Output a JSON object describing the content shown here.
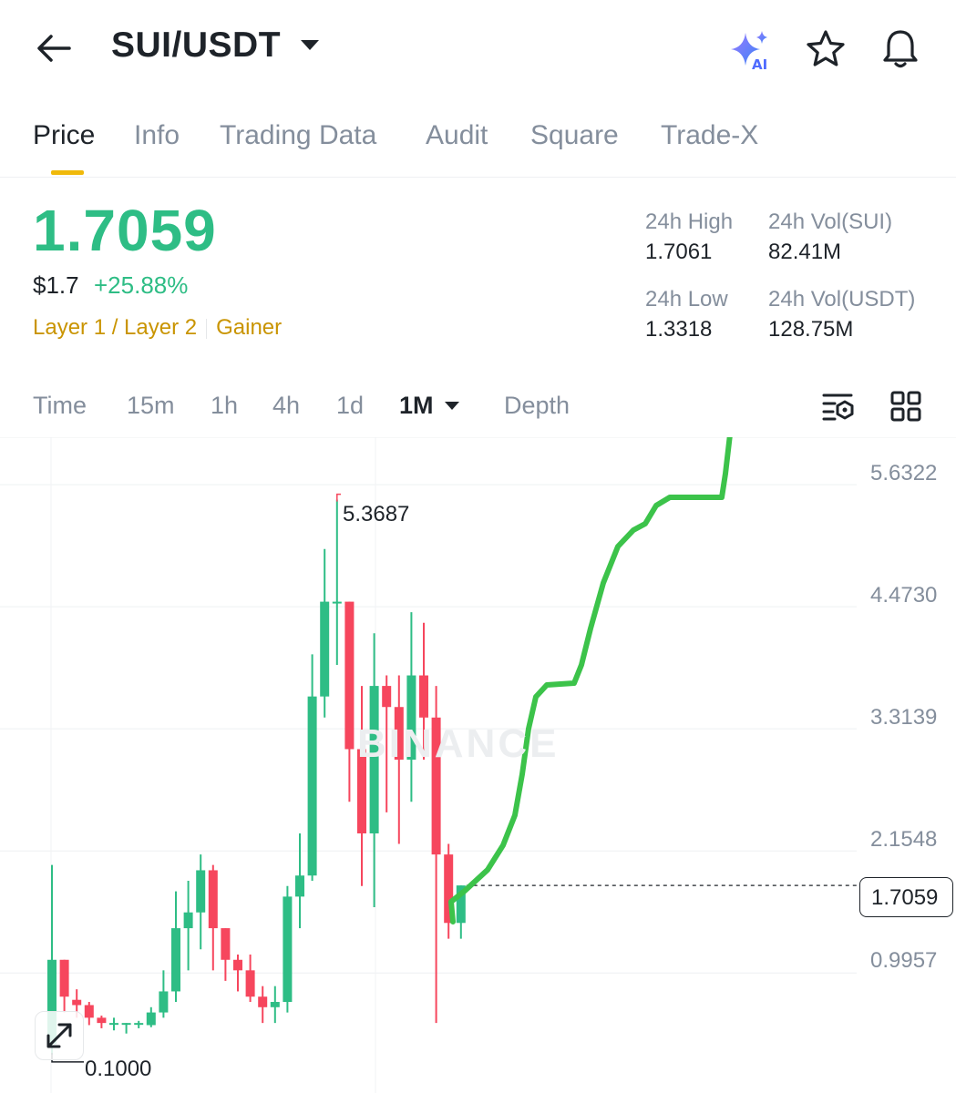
{
  "header": {
    "pair": "SUI/USDT",
    "icons": [
      "back-arrow-icon",
      "caret-down-icon",
      "ai-sparkle-icon",
      "star-icon",
      "bell-icon"
    ],
    "ai_label": "AI"
  },
  "tabs": [
    "Price",
    "Info",
    "Trading Data",
    "Audit",
    "Square",
    "Trade-X"
  ],
  "active_tab": "Price",
  "ticker": {
    "last_price": "1.7059",
    "usd_price": "$1.7",
    "change": "+25.88%",
    "tag1": "Layer 1 / Layer 2",
    "tag2": "Gainer",
    "high_label": "24h High",
    "high": "1.7061",
    "low_label": "24h Low",
    "low": "1.3318",
    "vol_base_label": "24h Vol(SUI)",
    "vol_base": "82.41M",
    "vol_quote_label": "24h Vol(USDT)",
    "vol_quote": "128.75M"
  },
  "intervals": [
    "Time",
    "15m",
    "1h",
    "4h",
    "1d",
    "1M",
    "Depth"
  ],
  "active_interval": "1M",
  "colors": {
    "up": "#2ebd85",
    "down": "#f6465d",
    "accent": "#f0b90b",
    "tag": "#c99400",
    "drawn_line": "#3cc34a"
  },
  "chart_data": {
    "type": "candlestick",
    "interval": "1M",
    "y_axis_ticks": [
      "5.6322",
      "4.4730",
      "3.3139",
      "2.1548",
      "0.9957"
    ],
    "ylim": [
      0.08,
      5.7
    ],
    "current_price": "1.7059",
    "high_marker": "5.3687",
    "low_marker": "0.1000",
    "watermark": "BINANCE",
    "candles": [
      [
        0.2,
        1.0,
        1.9,
        0.1
      ],
      [
        1.0,
        0.65,
        1.0,
        0.5
      ],
      [
        0.62,
        0.57,
        0.72,
        0.45
      ],
      [
        0.57,
        0.45,
        0.6,
        0.38
      ],
      [
        0.45,
        0.4,
        0.47,
        0.35
      ],
      [
        0.4,
        0.4,
        0.45,
        0.33
      ],
      [
        0.4,
        0.4,
        0.4,
        0.3
      ],
      [
        0.4,
        0.4,
        0.42,
        0.35
      ],
      [
        0.38,
        0.5,
        0.55,
        0.36
      ],
      [
        0.5,
        0.7,
        0.9,
        0.45
      ],
      [
        0.7,
        1.3,
        1.65,
        0.6
      ],
      [
        1.3,
        1.45,
        1.75,
        0.9
      ],
      [
        1.45,
        1.85,
        2.0,
        1.1
      ],
      [
        1.85,
        1.3,
        1.9,
        0.9
      ],
      [
        1.3,
        1.0,
        1.3,
        0.8
      ],
      [
        1.0,
        0.9,
        1.05,
        0.7
      ],
      [
        0.9,
        0.65,
        1.05,
        0.6
      ],
      [
        0.65,
        0.55,
        0.75,
        0.4
      ],
      [
        0.55,
        0.6,
        0.75,
        0.4
      ],
      [
        0.6,
        1.6,
        1.7,
        0.5
      ],
      [
        1.6,
        1.8,
        2.2,
        1.3
      ],
      [
        1.8,
        3.5,
        3.9,
        1.75
      ],
      [
        3.5,
        4.4,
        4.9,
        3.3
      ],
      [
        4.4,
        4.4,
        5.3687,
        3.8
      ],
      [
        4.4,
        3.0,
        4.4,
        2.5
      ],
      [
        3.0,
        2.2,
        3.6,
        1.7
      ],
      [
        2.2,
        3.6,
        4.1,
        1.5
      ],
      [
        3.6,
        3.4,
        3.7,
        2.4
      ],
      [
        3.4,
        2.9,
        3.7,
        2.1
      ],
      [
        2.9,
        3.7,
        4.3,
        2.5
      ],
      [
        3.7,
        3.3,
        4.2,
        2.9
      ],
      [
        3.3,
        2.0,
        3.6,
        0.4
      ],
      [
        2.0,
        1.35,
        2.1,
        1.2
      ],
      [
        1.35,
        1.7059,
        1.7061,
        1.2
      ]
    ],
    "drawn_projection": true
  }
}
